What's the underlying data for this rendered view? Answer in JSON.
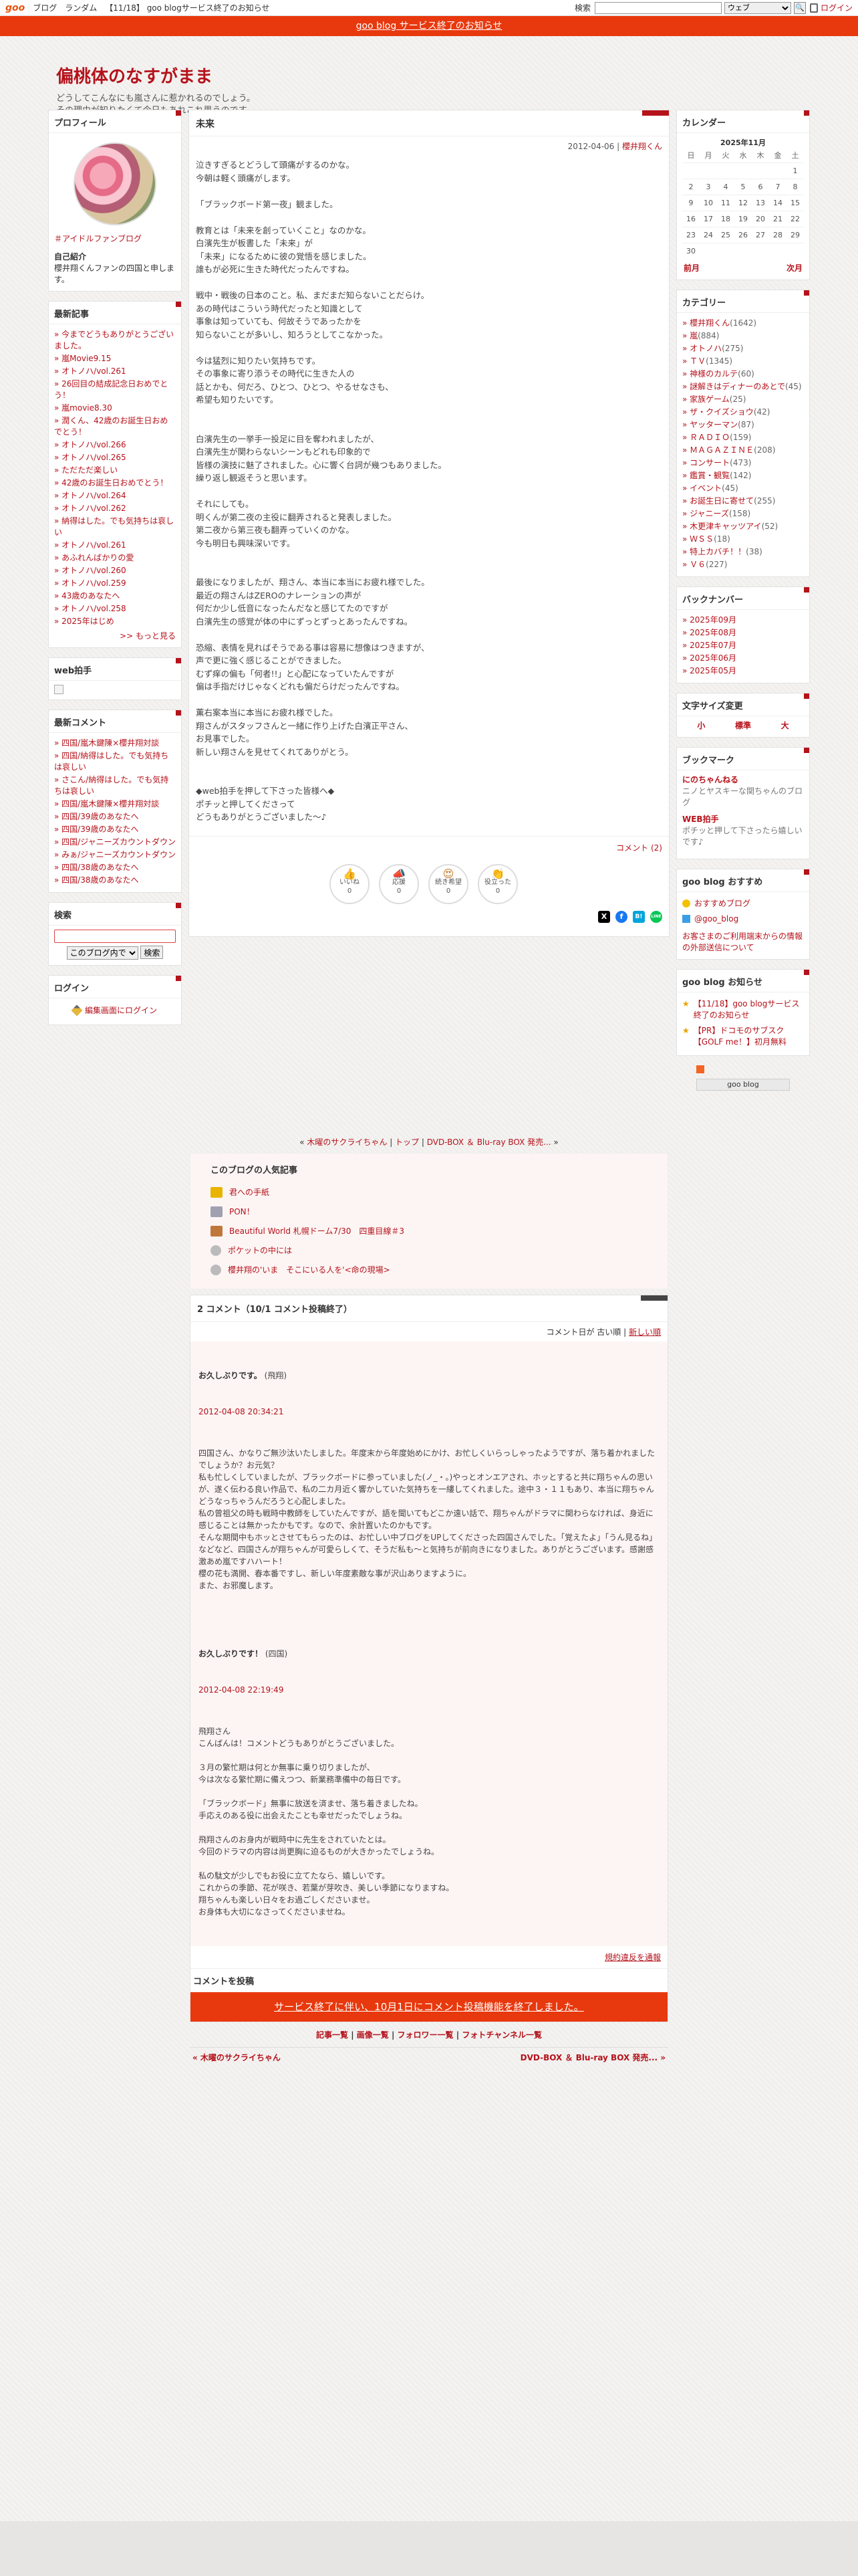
{
  "topbar": {
    "logo": "goo",
    "links": [
      "ブログ",
      "ランダム",
      "【11/18】 goo blogサービス終了のお知らせ"
    ],
    "search_label": "検索",
    "search_select": "ウェブ",
    "login": "ログイン"
  },
  "notice": "goo blog サービス終了のお知らせ",
  "blog": {
    "title": "偏桃体のなすがまま",
    "desc_1": "どうしてこんなにも嵐さんに惹かれるのでしょう。",
    "desc_2": "その理由が知りたくて今日もあれこれ思うのです。"
  },
  "profile": {
    "heading": "プロフィール",
    "tag": "＃アイドルファンブログ",
    "intro_heading": "自己紹介",
    "intro": "櫻井翔くんファンの四国と申します。"
  },
  "recent": {
    "heading": "最新記事",
    "items": [
      "今までどうもありがとうございました。",
      "嵐Movie9.15",
      "オトノハ/vol.261",
      "26回目の結成記念日おめでとう！",
      "嵐movie8.30",
      "潤くん、42歳のお誕生日おめでとう！",
      "オトノハ/vol.266",
      "オトノハ/vol.265",
      "ただただ楽しい",
      "42歳のお誕生日おめでとう！",
      "オトノハ/vol.264",
      "オトノハ/vol.262",
      "納得はした。でも気持ちは哀しい",
      "オトノハ/vol.261",
      "あふれんばかりの愛",
      "オトノハ/vol.260",
      "オトノハ/vol.259",
      "43歳のあなたへ",
      "オトノハ/vol.258",
      "2025年はじめ"
    ],
    "more": ">> もっと見る"
  },
  "webclap": {
    "heading": "web拍手"
  },
  "recent_comments": {
    "heading": "最新コメント",
    "items": [
      "四国/嵐木鍵陳×櫻井翔対談",
      "四国/納得はした。でも気持ちは哀しい",
      "さこん/納得はした。でも気持ちは哀しい",
      "四国/嵐木鍵陳×櫻井翔対談",
      "四国/39歳のあなたへ",
      "四国/39歳のあなたへ",
      "四国/ジャニーズカウントダウン",
      "みぁ/ジャニーズカウントダウン",
      "四国/38歳のあなたへ",
      "四国/38歳のあなたへ"
    ]
  },
  "search": {
    "heading": "検索",
    "select": "このブログ内で",
    "button": "検索"
  },
  "login": {
    "heading": "ログイン",
    "link": "編集画面にログイン"
  },
  "entry": {
    "title": "未来",
    "date": "2012-04-06",
    "author": "櫻井翔くん",
    "body": "泣きすぎるとどうして頭痛がするのかな。\n今朝は軽く頭痛がします。\n\n「ブラックボード第一夜」観ました。\n\n教育とは「未来を創っていくこと」なのかな。\n白濱先生が板書した「未来」が\n「未来」になるために彼の覚悟を感じました。\n誰もが必死に生きた時代だったんですね。\n\n戦中・戦後の日本のこと。私、まだまだ知らないことだらけ。\nあの時代はこういう時代だったと知識として\n事象は知っていても、何故そうであったかを\n知らないことが多いし、知ろうとしてこなかった。\n\n今は猛烈に知りたい気持ちです。\nその事象に寄り添うその時代に生きた人の\n話とかも、何だろ、ひとつ、ひとつ、やるせなさも、\n希望も知りたいです。\n\n\n白濱先生の一挙手一投足に目を奪われましたが、\n白濱先生が関わらないシーンもどれも印象的で\n皆様の演技に魅了されました。心に響く台詞が幾つもありました。\n繰り返し観返そうと思います。\n\nそれにしても。\n明くんが第二夜の主役に翻弄されると発表しました。\n第二夜から第三夜も翻弄っていくのかな。\n今も明日も興味深いです。\n\n\n最後になりましたが、翔さん、本当に本当にお疲れ様でした。\n最近の翔さんはZEROのナレーションの声が\n何だか少し低音になったんだなと感じてたのですが\n白濱先生の感覚が体の中にずっとずっとあったんですね。\n\n恐縮、表情を見ればそうである事は容易に想像はつきますが、\n声で更に強く感じることができました。\nむず痒の偏も「何者!!」と心配になっていたんですが\n偏は手指だけじゃなくどれも偏だらけだったんですね。\n\n薫右案本当に本当にお疲れ様でした。\n翔さんがスタッフさんと一緒に作り上げた白濱正平さん、\nお見事でした。\n新しい翔さんを見せてくれてありがとう。\n\n\n◆web拍手を押して下さった皆様へ◆\nポチッと押してくださって\nどうもありがとうございました〜♪",
    "comment_count": "コメント (2)"
  },
  "reactions": [
    {
      "label": "いいね",
      "count": "0",
      "icon": "thumbs-up-icon",
      "glyph": "👍"
    },
    {
      "label": "応援",
      "count": "0",
      "icon": "megaphone-icon",
      "glyph": "📣"
    },
    {
      "label": "続き希望",
      "count": "0",
      "icon": "heart-eyes-icon",
      "glyph": "😍"
    },
    {
      "label": "役立った",
      "count": "0",
      "icon": "clap-icon",
      "glyph": "👏"
    }
  ],
  "share": [
    "X",
    "f",
    "B!",
    "LINE"
  ],
  "calendar": {
    "heading": "カレンダー",
    "caption": "2025年11月",
    "weekdays": [
      "日",
      "月",
      "火",
      "水",
      "木",
      "金",
      "土"
    ],
    "weeks": [
      [
        "",
        "",
        "",
        "",
        "",
        "",
        "1"
      ],
      [
        "2",
        "3",
        "4",
        "5",
        "6",
        "7",
        "8"
      ],
      [
        "9",
        "10",
        "11",
        "12",
        "13",
        "14",
        "15"
      ],
      [
        "16",
        "17",
        "18",
        "19",
        "20",
        "21",
        "22"
      ],
      [
        "23",
        "24",
        "25",
        "26",
        "27",
        "28",
        "29"
      ],
      [
        "30",
        "",
        "",
        "",
        "",
        "",
        ""
      ]
    ],
    "prev": "前月",
    "next": "次月"
  },
  "categories": {
    "heading": "カテゴリー",
    "items": [
      {
        "name": "櫻井翔くん",
        "count": "(1642)"
      },
      {
        "name": "嵐",
        "count": "(884)"
      },
      {
        "name": "オトノハ",
        "count": "(275)"
      },
      {
        "name": "ＴＶ",
        "count": "(1345)"
      },
      {
        "name": "神様のカルテ",
        "count": "(60)"
      },
      {
        "name": "謎解きはディナーのあとで",
        "count": "(45)"
      },
      {
        "name": "家族ゲーム",
        "count": "(25)"
      },
      {
        "name": "ザ・クイズショウ",
        "count": "(42)"
      },
      {
        "name": "ヤッターマン",
        "count": "(87)"
      },
      {
        "name": "ＲＡＤＩＯ",
        "count": "(159)"
      },
      {
        "name": "ＭＡＧＡＺＩＮＥ",
        "count": "(208)"
      },
      {
        "name": "コンサート",
        "count": "(473)"
      },
      {
        "name": "鑑賞・観覧",
        "count": "(142)"
      },
      {
        "name": "イベント",
        "count": "(45)"
      },
      {
        "name": "お誕生日に寄せて",
        "count": "(255)"
      },
      {
        "name": "ジャニーズ",
        "count": "(158)"
      },
      {
        "name": "木更津キャッツアイ",
        "count": "(52)"
      },
      {
        "name": "ＷＳＳ",
        "count": "(18)"
      },
      {
        "name": "特上カバチ！！",
        "count": "(38)"
      },
      {
        "name": "Ｖ６",
        "count": "(227)"
      }
    ]
  },
  "backnumber": {
    "heading": "バックナンバー",
    "items": [
      "2025年09月",
      "2025年08月",
      "2025年07月",
      "2025年06月",
      "2025年05月"
    ]
  },
  "fontsize": {
    "heading": "文字サイズ変更",
    "small": "小",
    "std": "標準",
    "large": "大"
  },
  "bookmark": {
    "heading": "ブックマーク",
    "items": [
      {
        "title": "にのちゃんねる",
        "desc": "ニノとヤスキーな関ちゃんのブログ"
      },
      {
        "title": "WEB拍手",
        "desc": "ポチッと押して下さったら嬉しいです♪"
      }
    ]
  },
  "recommend": {
    "heading": "goo blog おすすめ",
    "items": [
      "おすすめブログ",
      "@goo_blog"
    ],
    "note": "お客さまのご利用端末からの情報の外部送信について"
  },
  "info": {
    "heading": "goo blog お知らせ",
    "items": [
      "【11/18】goo blogサービス終了のお知らせ",
      "【PR】ドコモのサブスク【GOLF me！】初月無料"
    ]
  },
  "goo_button": "goo blog",
  "navline": {
    "prev": "木曜のサクライちゃん",
    "top": "トップ",
    "next": "DVD-BOX ＆ Blu-ray BOX 発売..."
  },
  "popular": {
    "heading": "このブログの人気記事",
    "items": [
      "君への手紙",
      "PON！",
      "Beautiful World 札幌ドーム7/30　四重目線＃3",
      "ポケットの中には",
      "櫻井翔の'いま　そこにいる人を'<命の現場>"
    ]
  },
  "comments": {
    "heading": "2 コメント（10/1 コメント投稿終了）",
    "sort_label": "コメント日が",
    "sort_old": "古い順",
    "sort_new": "新しい順",
    "items": [
      {
        "title": "お久しぶりです。",
        "author": "(飛翔)",
        "date": "2012-04-08 20:34:21",
        "body": "四国さん、かなりご無沙汰いたしました。年度末から年度始めにかけ、お忙しくいらっしゃったようですが、落ち着かれましたでしょうか？お元気？\n私も忙しくしていましたが、ブラックボードに参っていました(ノ_・。)やっとオンエアされ、ホッとすると共に翔ちゃんの思いが、遂く伝わる良い作品で、私の二カ月近く響かしていた気持ちを一縷してくれました。途中３・１１もあり、本当に翔ちゃんどうなっちゃうんだろうと心配しました。\n私の曾祖父の時も戦時中教師をしていたんですが、語を聞いてもどこか遠い話で、翔ちゃんがドラマに関わらなければ、身近に感じることは無かったかもです。なので、余計置いたのかもです。\nそんな期間中もホッとさせてもらったのは、お忙しい中ブログをUPしてくださった四国さんでした。「覚えたよ」「うん見るね」などなど、四国さんが翔ちゃんが可愛らしくて、そうだ私も〜と気持ちが前向きになりました。ありがとうございます。感謝感激あめ嵐ですハハート！\n櫻の花も満開、春本番ですし、新しい年度素敵な事が沢山ありますように。\nまた、お邪魔します。"
      },
      {
        "title": "お久しぶりです！",
        "author": "(四国)",
        "date": "2012-04-08 22:19:49",
        "body": "飛翔さん\nこんばんは！コメントどうもありがとうございました。\n\n３月の繁忙期は何とか無事に乗り切りましたが、\n今は次なる繁忙期に備えつつ、新業務準備中の毎日です。\n\n「ブラックボード」無事に放送を済ませ、落ち着きましたね。\n手応えのある役に出会えたことも幸せだったでしょうね。\n\n飛翔さんのお身内が戦時中に先生をされていたとは。\n今回のドラマの内容は尚更胸に迫るものが大きかったでしょうね。\n\n私の駄文が少しでもお役に立てたなら、嬉しいです。\nこれからの季節、花が咲き、若葉が芽吹き、美しい季節になりますね。\n翔ちゃんも楽しい日々をお過ごしくださいませ。\nお身体も大切になさってくださいませね。"
      }
    ],
    "rules": "規約違反を通報",
    "post_heading": "コメントを投稿",
    "closed": "サービス終了に伴い、10月1日にコメント投稿機能を終了しました。"
  },
  "bottom_links": [
    "記事一覧",
    "画像一覧",
    "フォロワー一覧",
    "フォトチャンネル一覧"
  ],
  "pager": {
    "prev": "« 木曜のサクライちゃん",
    "next": "DVD-BOX ＆ Blu-ray BOX 発売... »"
  }
}
